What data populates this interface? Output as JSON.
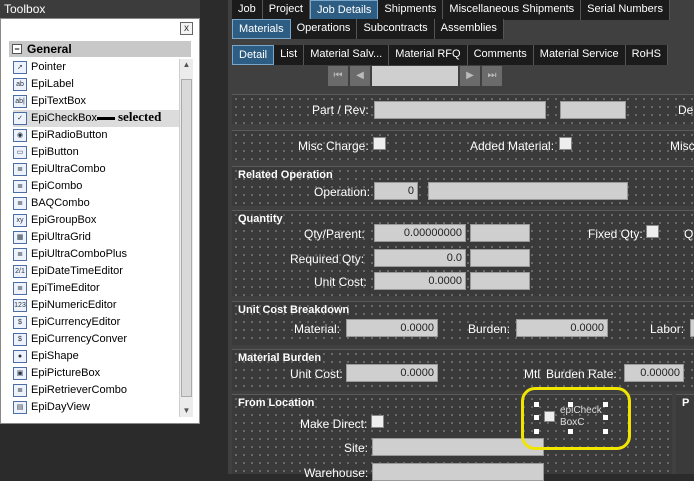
{
  "toolbox": {
    "title": "Toolbox",
    "close": "x",
    "category": "General",
    "category_toggle": "−",
    "items": [
      {
        "label": "Pointer",
        "icon": "pointer-icon",
        "glyph": "➚"
      },
      {
        "label": "EpiLabel",
        "icon": "label-icon",
        "glyph": "ab"
      },
      {
        "label": "EpiTextBox",
        "icon": "textbox-icon",
        "glyph": "ab|"
      },
      {
        "label": "EpiCheckBox",
        "icon": "checkbox-icon",
        "glyph": "✓"
      },
      {
        "label": "EpiRadioButton",
        "icon": "radio-icon",
        "glyph": "◉"
      },
      {
        "label": "EpiButton",
        "icon": "button-icon",
        "glyph": "▭"
      },
      {
        "label": "EpiUltraCombo",
        "icon": "ultracombo-icon",
        "glyph": "≣"
      },
      {
        "label": "EpiCombo",
        "icon": "combo-icon",
        "glyph": "≣"
      },
      {
        "label": "BAQCombo",
        "icon": "baqcombo-icon",
        "glyph": "≣"
      },
      {
        "label": "EpiGroupBox",
        "icon": "groupbox-icon",
        "glyph": "xy"
      },
      {
        "label": "EpiUltraGrid",
        "icon": "grid-icon",
        "glyph": "▦"
      },
      {
        "label": "EpiUltraComboPlus",
        "icon": "combo-plus-icon",
        "glyph": "≣"
      },
      {
        "label": "EpiDateTimeEditor",
        "icon": "datetime-icon",
        "glyph": "2/1"
      },
      {
        "label": "EpiTimeEditor",
        "icon": "time-icon",
        "glyph": "≣"
      },
      {
        "label": "EpiNumericEditor",
        "icon": "numeric-icon",
        "glyph": "123"
      },
      {
        "label": "EpiCurrencyEditor",
        "icon": "currency-icon",
        "glyph": "$"
      },
      {
        "label": "EpiCurrencyConver",
        "icon": "currency-convert-icon",
        "glyph": "$"
      },
      {
        "label": "EpiShape",
        "icon": "shape-icon",
        "glyph": "●"
      },
      {
        "label": "EpiPictureBox",
        "icon": "picture-icon",
        "glyph": "▣"
      },
      {
        "label": "EpiRetrieverCombo",
        "icon": "retriever-icon",
        "glyph": "≣"
      },
      {
        "label": "EpiDayView",
        "icon": "dayview-icon",
        "glyph": "▤"
      }
    ],
    "annotation": "selected"
  },
  "top_tabs": [
    "Job",
    "Project",
    "Job Details",
    "Shipments",
    "Miscellaneous Shipments",
    "Serial Numbers"
  ],
  "sub_tabs": [
    "Materials",
    "Operations",
    "Subcontracts",
    "Assemblies"
  ],
  "detail_tabs": [
    "Detail",
    "List",
    "Material Salv...",
    "Material RFQ",
    "Comments",
    "Material Service",
    "RoHS"
  ],
  "form": {
    "part_rev": "Part / Rev:",
    "de": "De",
    "misc_charge": "Misc Charge:",
    "added_material": "Added Material:",
    "misc": "Misc",
    "related_operation": "Related Operation",
    "operation": "Operation:",
    "operation_val": "0",
    "quantity": "Quantity",
    "qty_parent": "Qty/Parent:",
    "qty_parent_val": "0.00000000",
    "fixed_qty": "Fixed Qty:",
    "q": "Q",
    "required_qty": "Required Qty:",
    "required_qty_val": "0.0",
    "unit_cost": "Unit Cost:",
    "unit_cost_val": "0.0000",
    "unit_cost_breakdown": "Unit Cost Breakdown",
    "material": "Material:",
    "material_val": "0.0000",
    "burden": "Burden:",
    "burden_val": "0.0000",
    "labor": "Labor:",
    "material_burden": "Material Burden",
    "mb_unit_cost": "Unit Cost:",
    "mb_unit_cost_val": "0.0000",
    "mtl": "Mtl",
    "burden_rate": "Burden Rate:",
    "burden_rate_val": "0.00000",
    "from_location": "From Location",
    "make_direct": "Make Direct:",
    "site": "Site:",
    "warehouse": "Warehouse:",
    "p": "P",
    "new_checkbox": "epiCheckBoxC"
  }
}
